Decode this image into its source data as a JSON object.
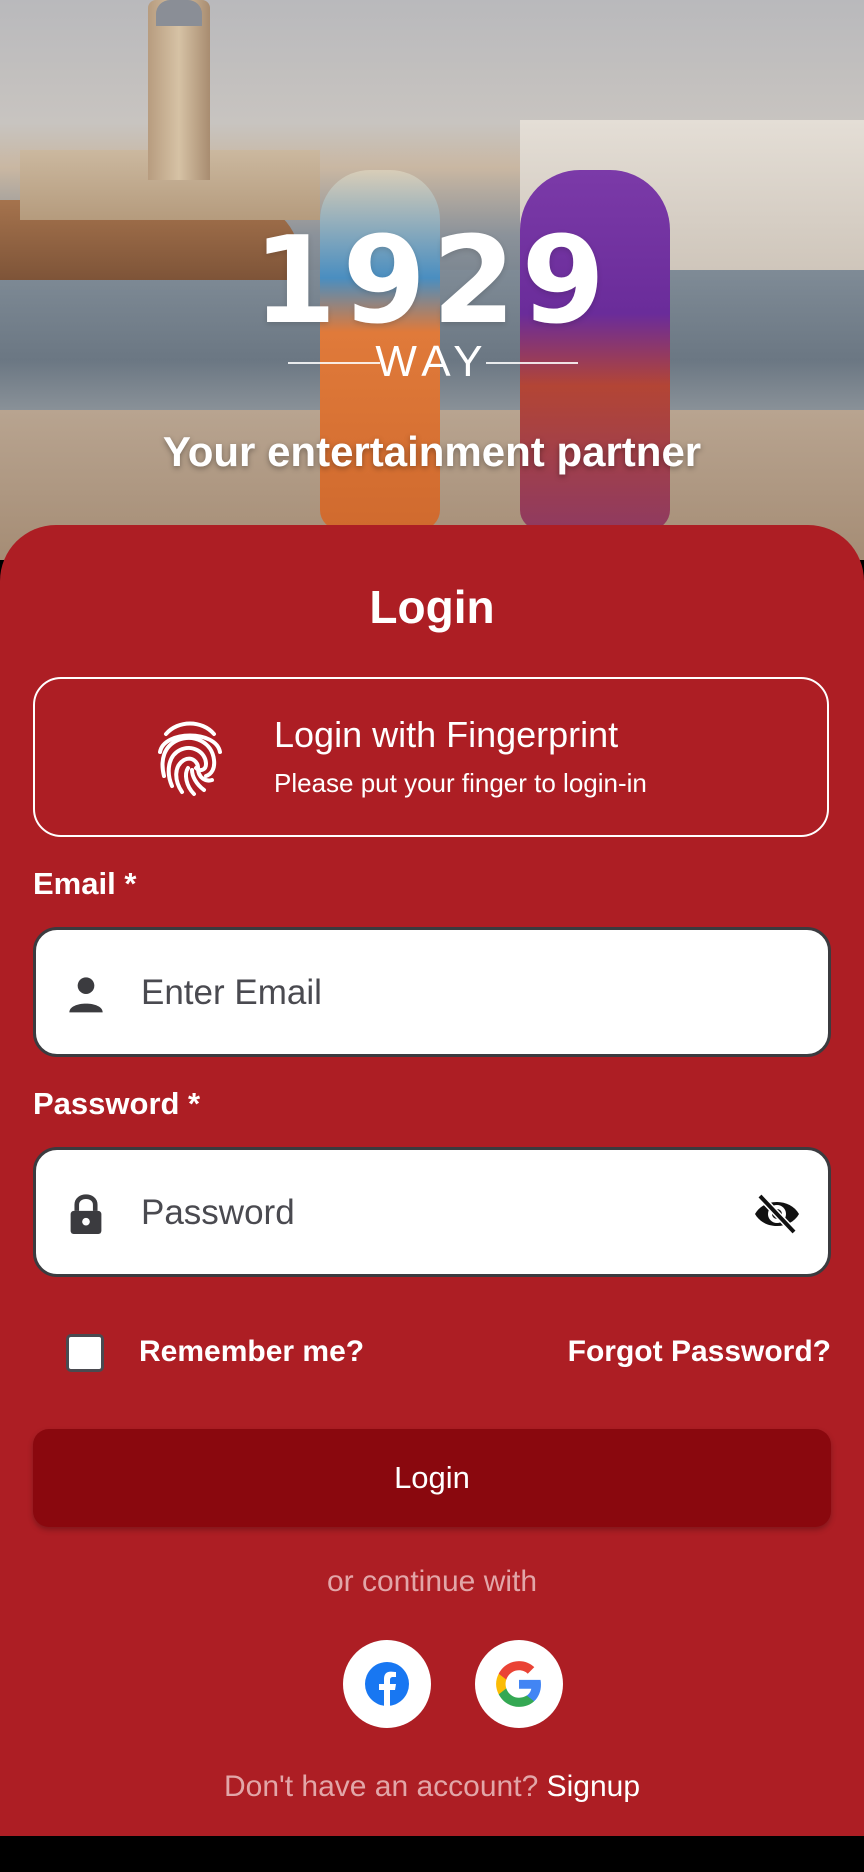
{
  "brand": {
    "logo_number": "1929",
    "logo_word": "WAY",
    "tagline": "Your entertainment partner"
  },
  "card": {
    "title": "Login"
  },
  "fingerprint": {
    "title": "Login with Fingerprint",
    "subtitle": "Please put your finger to login-in",
    "icon": "fingerprint-icon"
  },
  "email": {
    "label": "Email *",
    "placeholder": "Enter Email",
    "value": "",
    "icon": "person-icon"
  },
  "password": {
    "label": "Password *",
    "placeholder": "Password",
    "value": "",
    "icon": "lock-icon",
    "toggle_icon": "eye-off-icon"
  },
  "options": {
    "remember_label": "Remember me?",
    "remember_checked": false,
    "forgot_label": "Forgot Password?"
  },
  "actions": {
    "login_label": "Login",
    "or_text": "or continue with",
    "social": [
      "facebook-icon",
      "google-icon"
    ]
  },
  "footer": {
    "question": "Don't have an account?",
    "signup_label": "Signup"
  },
  "colors": {
    "card": "#ad1e24",
    "button": "#8a080e",
    "muted_text": "#e2a6a8"
  }
}
